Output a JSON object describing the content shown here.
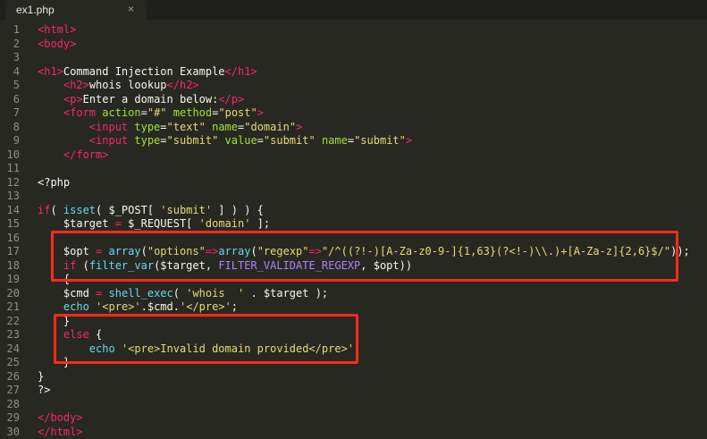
{
  "tab": {
    "title": "ex1.php",
    "close_glyph": "×"
  },
  "lines": [
    {
      "n": "1",
      "t": [
        [
          "tag",
          "<html>"
        ]
      ]
    },
    {
      "n": "2",
      "t": [
        [
          "tag",
          "<body>"
        ]
      ]
    },
    {
      "n": "3",
      "t": []
    },
    {
      "n": "4",
      "t": [
        [
          "tag",
          "<h1>"
        ],
        [
          "txt",
          "Command Injection Example"
        ],
        [
          "tag",
          "</h1>"
        ]
      ]
    },
    {
      "n": "5",
      "t": [
        [
          "txt",
          "    "
        ],
        [
          "tag",
          "<h2>"
        ],
        [
          "txt",
          "whois lookup"
        ],
        [
          "tag",
          "</h2>"
        ]
      ]
    },
    {
      "n": "6",
      "t": [
        [
          "txt",
          "    "
        ],
        [
          "tag",
          "<p>"
        ],
        [
          "txt",
          "Enter a domain below:"
        ],
        [
          "tag",
          "</p>"
        ]
      ]
    },
    {
      "n": "7",
      "t": [
        [
          "txt",
          "    "
        ],
        [
          "tag",
          "<form "
        ],
        [
          "attr",
          "action"
        ],
        [
          "txt",
          "="
        ],
        [
          "str",
          "\"#\""
        ],
        [
          "txt",
          " "
        ],
        [
          "attr",
          "method"
        ],
        [
          "txt",
          "="
        ],
        [
          "str",
          "\"post\""
        ],
        [
          "tag",
          ">"
        ]
      ]
    },
    {
      "n": "8",
      "t": [
        [
          "txt",
          "        "
        ],
        [
          "tag",
          "<input "
        ],
        [
          "attr",
          "type"
        ],
        [
          "txt",
          "="
        ],
        [
          "str",
          "\"text\""
        ],
        [
          "txt",
          " "
        ],
        [
          "attr",
          "name"
        ],
        [
          "txt",
          "="
        ],
        [
          "str",
          "\"domain\""
        ],
        [
          "tag",
          ">"
        ]
      ]
    },
    {
      "n": "9",
      "t": [
        [
          "txt",
          "        "
        ],
        [
          "tag",
          "<input "
        ],
        [
          "attr",
          "type"
        ],
        [
          "txt",
          "="
        ],
        [
          "str",
          "\"submit\""
        ],
        [
          "txt",
          " "
        ],
        [
          "attr",
          "value"
        ],
        [
          "txt",
          "="
        ],
        [
          "str",
          "\"submit\""
        ],
        [
          "txt",
          " "
        ],
        [
          "attr",
          "name"
        ],
        [
          "txt",
          "="
        ],
        [
          "str",
          "\"submit\""
        ],
        [
          "tag",
          ">"
        ]
      ]
    },
    {
      "n": "10",
      "t": [
        [
          "txt",
          "    "
        ],
        [
          "tag",
          "</form>"
        ]
      ]
    },
    {
      "n": "11",
      "t": []
    },
    {
      "n": "12",
      "t": [
        [
          "txt",
          "<?php"
        ]
      ]
    },
    {
      "n": "13",
      "t": []
    },
    {
      "n": "14",
      "t": [
        [
          "kw",
          "if"
        ],
        [
          "txt",
          "( "
        ],
        [
          "fn",
          "isset"
        ],
        [
          "txt",
          "( $_POST[ "
        ],
        [
          "str",
          "'submit'"
        ],
        [
          "txt",
          " ] ) ) {"
        ]
      ]
    },
    {
      "n": "15",
      "t": [
        [
          "txt",
          "    $target "
        ],
        [
          "kw",
          "="
        ],
        [
          "txt",
          " $_REQUEST[ "
        ],
        [
          "str",
          "'domain'"
        ],
        [
          "txt",
          " ];"
        ]
      ]
    },
    {
      "n": "16",
      "t": []
    },
    {
      "n": "17",
      "t": [
        [
          "txt",
          "    $opt "
        ],
        [
          "kw",
          "="
        ],
        [
          "txt",
          " "
        ],
        [
          "fn",
          "array"
        ],
        [
          "txt",
          "("
        ],
        [
          "str",
          "\"options\""
        ],
        [
          "kw",
          "=>"
        ],
        [
          "fn",
          "array"
        ],
        [
          "txt",
          "("
        ],
        [
          "str",
          "\"regexp\""
        ],
        [
          "kw",
          "=>"
        ],
        [
          "str",
          "\"/^((?!-)[A-Za-z0-9-]{1,63}(?<!-)\\\\.)+[A-Za-z]{2,6}$/\""
        ],
        [
          "txt",
          "));"
        ]
      ]
    },
    {
      "n": "18",
      "t": [
        [
          "txt",
          "    "
        ],
        [
          "kw",
          "if"
        ],
        [
          "txt",
          " ("
        ],
        [
          "fn",
          "filter_var"
        ],
        [
          "txt",
          "($target, "
        ],
        [
          "cst",
          "FILTER_VALIDATE_REGEXP"
        ],
        [
          "txt",
          ", $opt))"
        ]
      ]
    },
    {
      "n": "19",
      "t": [
        [
          "txt",
          "    {"
        ]
      ]
    },
    {
      "n": "20",
      "t": [
        [
          "txt",
          "    $cmd "
        ],
        [
          "kw",
          "="
        ],
        [
          "txt",
          " "
        ],
        [
          "fn",
          "shell_exec"
        ],
        [
          "txt",
          "( "
        ],
        [
          "str",
          "'whois  '"
        ],
        [
          "txt",
          " . $target );"
        ]
      ]
    },
    {
      "n": "21",
      "t": [
        [
          "txt",
          "    "
        ],
        [
          "fn",
          "echo"
        ],
        [
          "txt",
          " "
        ],
        [
          "str",
          "'<pre>'"
        ],
        [
          "txt",
          "."
        ],
        [
          "txt",
          "$cmd"
        ],
        [
          "txt",
          "."
        ],
        [
          "str",
          "'</pre>'"
        ],
        [
          "txt",
          ";"
        ]
      ]
    },
    {
      "n": "22",
      "t": [
        [
          "txt",
          "    }"
        ]
      ]
    },
    {
      "n": "23",
      "t": [
        [
          "txt",
          "    "
        ],
        [
          "kw",
          "else"
        ],
        [
          "txt",
          " {"
        ]
      ]
    },
    {
      "n": "24",
      "t": [
        [
          "txt",
          "        "
        ],
        [
          "fn",
          "echo"
        ],
        [
          "txt",
          " "
        ],
        [
          "str",
          "'<pre>Invalid domain provided</pre>'"
        ],
        [
          "txt",
          ";"
        ]
      ]
    },
    {
      "n": "25",
      "t": [
        [
          "txt",
          "    }"
        ]
      ]
    },
    {
      "n": "26",
      "t": [
        [
          "txt",
          "}"
        ]
      ]
    },
    {
      "n": "27",
      "t": [
        [
          "txt",
          "?>"
        ]
      ]
    },
    {
      "n": "28",
      "t": []
    },
    {
      "n": "29",
      "t": [
        [
          "tag",
          "</body>"
        ]
      ]
    },
    {
      "n": "30",
      "t": [
        [
          "tag",
          "</html>"
        ]
      ]
    }
  ],
  "colors": {
    "background": "#272822",
    "tag": "#f92672",
    "attribute": "#a6e22e",
    "function": "#66d9ef",
    "string": "#e6db74",
    "constant": "#ae81ff",
    "highlight_box": "#ff2a1a"
  }
}
